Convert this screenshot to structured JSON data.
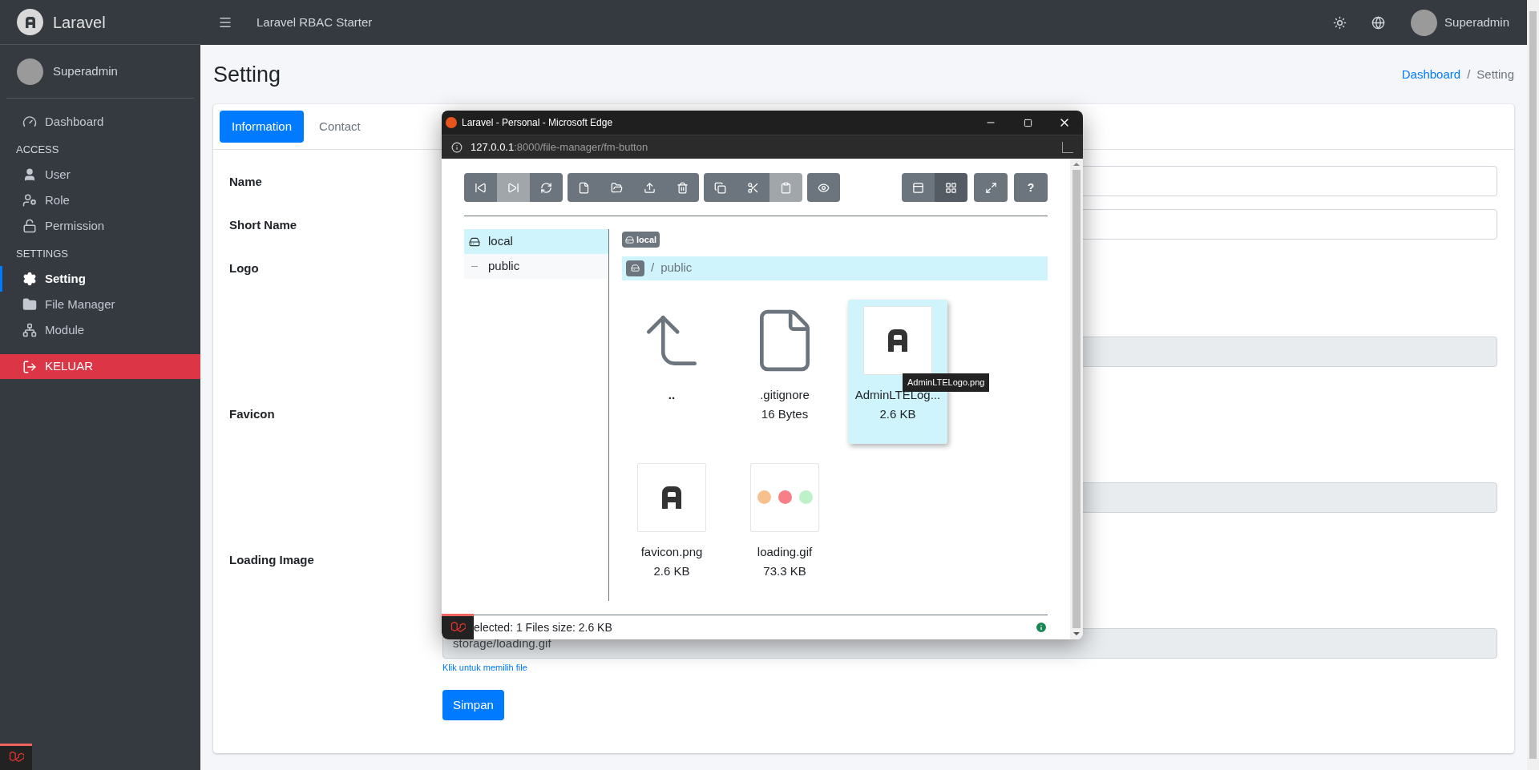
{
  "sidebar": {
    "brand": "Laravel",
    "user": "Superadmin",
    "items": [
      {
        "kind": "item",
        "label": "Dashboard",
        "selected": false
      },
      {
        "kind": "header",
        "label": "ACCESS"
      },
      {
        "kind": "item",
        "label": "User",
        "selected": false
      },
      {
        "kind": "item",
        "label": "Role",
        "selected": false
      },
      {
        "kind": "item",
        "label": "Permission",
        "selected": false
      },
      {
        "kind": "header",
        "label": "SETTINGS"
      },
      {
        "kind": "item",
        "label": "Setting",
        "selected": true
      },
      {
        "kind": "item",
        "label": "File Manager",
        "selected": false
      },
      {
        "kind": "item",
        "label": "Module",
        "selected": false
      },
      {
        "kind": "logout",
        "label": "KELUAR",
        "selected": false
      }
    ]
  },
  "topbar": {
    "title": "Laravel RBAC Starter",
    "user": "Superadmin"
  },
  "page": {
    "title": "Setting",
    "breadcrumb_separator": "/",
    "breadcrumb": [
      {
        "kind": "link",
        "label": "Dashboard"
      },
      {
        "kind": "current",
        "label": "Setting"
      }
    ]
  },
  "tabs": [
    {
      "label": "Information",
      "selected": true
    },
    {
      "label": "Contact",
      "selected": false
    }
  ],
  "form": {
    "fields": [
      {
        "kind": "text",
        "label": "Name"
      },
      {
        "kind": "text",
        "label": "Short Name"
      },
      {
        "kind": "file",
        "label": "Logo"
      },
      {
        "kind": "file",
        "label": "Favicon"
      },
      {
        "kind": "file",
        "label": "Loading Image",
        "value": "storage/loading.gif",
        "hint": "Klik untuk memilih file"
      }
    ],
    "submit": "Simpan"
  },
  "popup": {
    "title": "Laravel - Personal - Microsoft Edge",
    "url_host": "127.0.0.1",
    "url_rest": ":8000/file-manager/fm-button",
    "toolbar_left": [
      [
        {
          "kind": "back",
          "disabled": false
        },
        {
          "kind": "forward",
          "disabled": true
        },
        {
          "kind": "refresh",
          "disabled": false
        }
      ],
      [
        {
          "kind": "newfile",
          "disabled": false
        },
        {
          "kind": "newfolder",
          "disabled": false
        },
        {
          "kind": "upload",
          "disabled": false
        },
        {
          "kind": "delete",
          "disabled": false
        }
      ],
      [
        {
          "kind": "copy",
          "disabled": false
        },
        {
          "kind": "cut",
          "disabled": false
        },
        {
          "kind": "paste",
          "disabled": true
        }
      ],
      [
        {
          "kind": "preview",
          "disabled": false
        }
      ]
    ],
    "view_buttons": [
      {
        "kind": "table",
        "selected": false
      },
      {
        "kind": "grid",
        "selected": true
      }
    ],
    "help": "?",
    "tree": [
      {
        "kind": "disk",
        "label": "local",
        "selected": true
      },
      {
        "kind": "folder",
        "label": "public",
        "selected": false
      }
    ],
    "disk_badge": "local",
    "path_separator": "/",
    "path": "public",
    "files": [
      {
        "kind": "up",
        "name": "..",
        "selected": false
      },
      {
        "kind": "file",
        "name": ".gitignore",
        "size": "16 Bytes",
        "selected": false
      },
      {
        "kind": "logo",
        "name": "AdminLTELog...",
        "size": "2.6 KB",
        "selected": true
      },
      {
        "kind": "logo",
        "name": "favicon.png",
        "size": "2.6 KB",
        "selected": false
      },
      {
        "kind": "dots",
        "name": "loading.gif",
        "size": "73.3 KB",
        "selected": false
      }
    ],
    "tooltip": "AdminLTELogo.png",
    "status": "elected: 1 Files size: 2.6 KB"
  }
}
